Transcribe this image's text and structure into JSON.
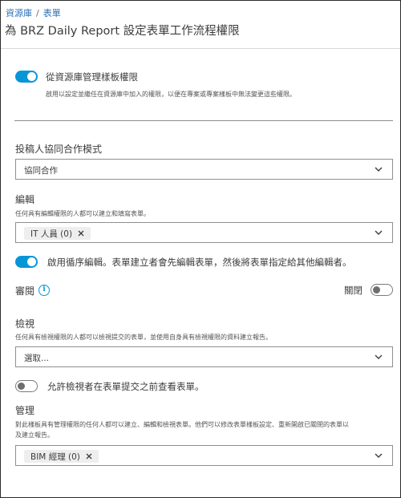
{
  "breadcrumb": {
    "root": "資源庫",
    "separator": "/",
    "current": "表單"
  },
  "page_title": "為 BRZ Daily Report 設定表單工作流程權限",
  "library_permissions": {
    "toggle_label": "從資源庫管理樣板權限",
    "toggle_state": "on",
    "description": "啟用以設定並繼任在資源庫中加入的權限，以便在專案或專案樣板中無法變更這些權限。"
  },
  "collaboration_mode": {
    "label": "投稿人協同合作模式",
    "selected": "協同合作"
  },
  "edit": {
    "label": "編輯",
    "description": "任何具有編輯權限的人都可以建立和填寫表單。",
    "chips": [
      "IT 人員 (0)"
    ]
  },
  "sequential_edit": {
    "toggle_state": "on",
    "label": "啟用循序編輯。表單建立者會先編輯表單，然後將表單指定給其他編輯者。"
  },
  "review": {
    "label": "審閱",
    "toggle_label": "關閉",
    "toggle_state": "off"
  },
  "view": {
    "label": "檢視",
    "description": "任何具有檢視權限的人都可以檢視提交的表單，並使用自身具有檢視權限的資料建立報告。",
    "placeholder": "選取..."
  },
  "allow_preview": {
    "toggle_state": "off",
    "label": "允許檢視者在表單提交之前查看表單。"
  },
  "manage": {
    "label": "管理",
    "description_line1": "對此樣板具有管理權限的任何人都可以建立、編輯和檢視表單。他們可以修改表單樣板設定、重新開啟已關閉的表單以",
    "description_line2": "及建立報告。",
    "chips": [
      "BIM 經理 (0)"
    ]
  },
  "colors": {
    "accent": "#0696d7",
    "link": "#2d6fb6"
  },
  "icons": {
    "info": "info-icon",
    "dropdown": "chevron-down-icon",
    "remove": "close-icon"
  }
}
